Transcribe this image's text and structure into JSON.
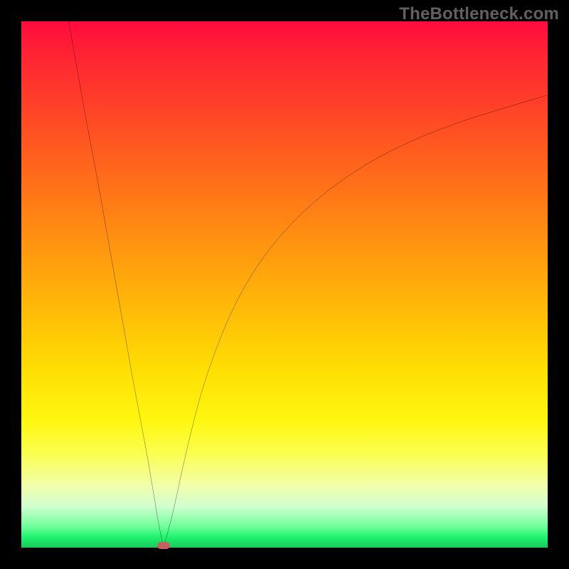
{
  "watermark": "TheBottleneck.com",
  "colors": {
    "frame": "#000000",
    "marker": "#c46060",
    "curve": "#000000"
  },
  "chart_data": {
    "type": "line",
    "title": "",
    "xlabel": "",
    "ylabel": "",
    "x_range": [
      0,
      100
    ],
    "y_range": [
      0,
      100
    ],
    "background_gradient": {
      "top": "red",
      "middle": "yellow",
      "bottom": "green"
    },
    "minimum_x": 27,
    "minimum_y": 0,
    "curve_points": [
      {
        "x": 9,
        "y": 100
      },
      {
        "x": 12,
        "y": 83
      },
      {
        "x": 15,
        "y": 67
      },
      {
        "x": 18,
        "y": 50
      },
      {
        "x": 21,
        "y": 33
      },
      {
        "x": 24,
        "y": 17
      },
      {
        "x": 26,
        "y": 5
      },
      {
        "x": 27,
        "y": 0
      },
      {
        "x": 28.5,
        "y": 5
      },
      {
        "x": 31,
        "y": 17
      },
      {
        "x": 35,
        "y": 33
      },
      {
        "x": 42,
        "y": 50
      },
      {
        "x": 52,
        "y": 63
      },
      {
        "x": 65,
        "y": 73
      },
      {
        "x": 80,
        "y": 80
      },
      {
        "x": 100,
        "y": 86
      }
    ],
    "marker": {
      "x": 27,
      "y": 0
    }
  }
}
